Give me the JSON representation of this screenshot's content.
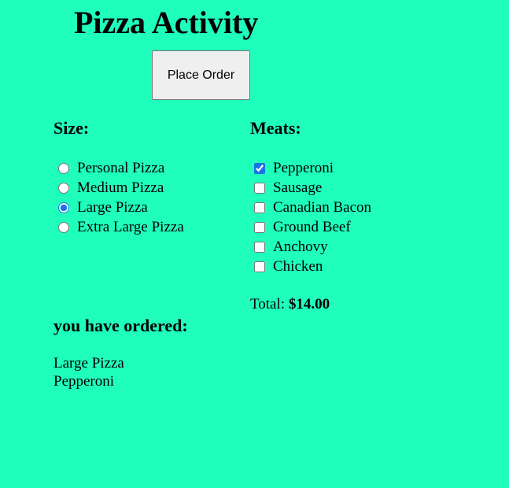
{
  "page": {
    "title": "Pizza Activity",
    "background_color": "#1fffbb"
  },
  "actions": {
    "place_order_label": "Place Order"
  },
  "size_section": {
    "heading": "Size:",
    "selected": "Large Pizza",
    "options": [
      {
        "label": "Personal Pizza",
        "checked": false
      },
      {
        "label": "Medium Pizza",
        "checked": false
      },
      {
        "label": "Large Pizza",
        "checked": true
      },
      {
        "label": "Extra Large Pizza",
        "checked": false
      }
    ]
  },
  "meats_section": {
    "heading": "Meats:",
    "options": [
      {
        "label": "Pepperoni",
        "checked": true
      },
      {
        "label": "Sausage",
        "checked": false
      },
      {
        "label": "Canadian Bacon",
        "checked": false
      },
      {
        "label": "Ground Beef",
        "checked": false
      },
      {
        "label": "Anchovy",
        "checked": false
      },
      {
        "label": "Chicken",
        "checked": false
      }
    ]
  },
  "total": {
    "label": "Total:",
    "amount": "$14.00"
  },
  "order_summary": {
    "heading": "you have ordered:",
    "items": [
      "Large Pizza",
      "Pepperoni"
    ]
  }
}
